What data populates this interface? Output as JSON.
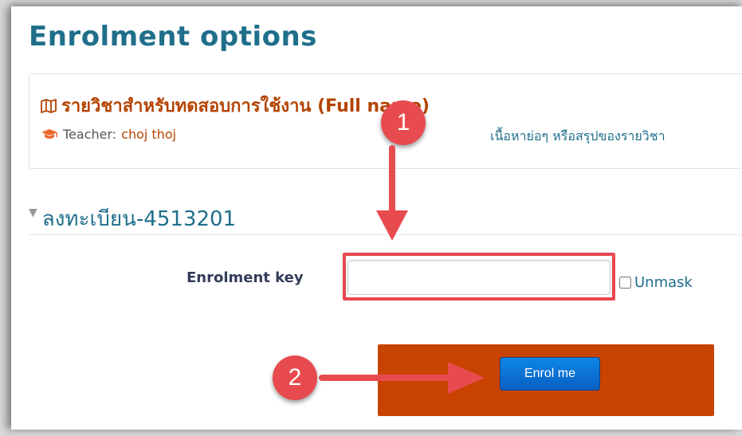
{
  "page": {
    "title": "Enrolment options"
  },
  "course": {
    "full_name": "รายวิชาสำหรับทดสอบการใช้งาน (Full name)",
    "teacher_label": "Teacher:",
    "teacher_name": "choj thoj",
    "summary": "เนื้อหาย่อๆ หรือสรุปของรายวิชา",
    "name_icon": "map-icon",
    "teacher_icon": "graduation-cap-icon"
  },
  "enrolment": {
    "section_title": "ลงทะเบียน-4513201",
    "key_label": "Enrolment key",
    "key_value": "",
    "unmask_label": "Unmask",
    "unmask_checked": false,
    "button_label": "Enrol me"
  },
  "annotations": {
    "step1": "1",
    "step2": "2",
    "color": "#e84b4f"
  },
  "colors": {
    "heading": "#1f6f8b",
    "course_name": "#b54300",
    "action_bar": "#c94300",
    "button": "#0a6fd6"
  }
}
